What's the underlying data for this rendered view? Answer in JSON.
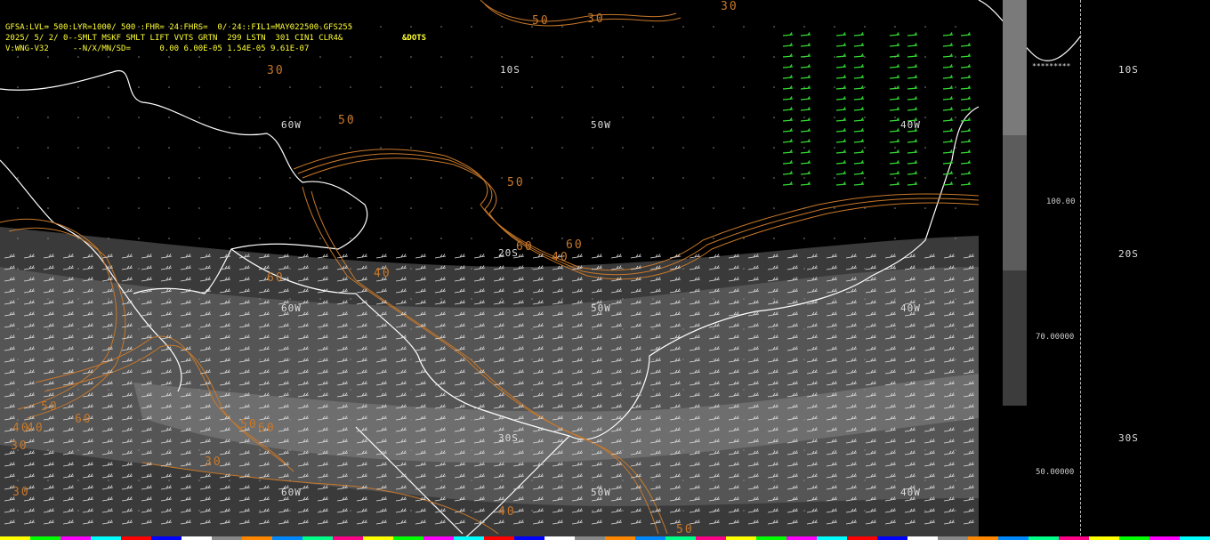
{
  "header": {
    "line1": "GFSA:LVL= 500:LYR=1000/ 500 :FHR= 24:FHRS=  0/ 24::FIL1=MAY022500.GFS255",
    "line2": "2025/ 5/ 2/ 0--SMLT MSKF SMLT LIFT VVTS GRTN  299 LSTN  301 CIN1 CLR4&",
    "line2_tag": "&DOTS",
    "line3": "V:WNG-V32     --N/X/MN/SD=      0.00 6.00E-05 1.54E-05 9.61E-07"
  },
  "map_labels": {
    "lat": [
      "10S",
      "20S",
      "30S"
    ],
    "lon": [
      "60W",
      "50W",
      "40W"
    ]
  },
  "contours": {
    "labels": [
      "30",
      "40",
      "50",
      "60",
      "30",
      "40",
      "50",
      "60",
      "60",
      "50",
      "40",
      "50",
      "30",
      "60",
      "60",
      "50",
      "40",
      "30",
      "30",
      "30",
      "40",
      "50"
    ]
  },
  "colorbar": {
    "values": [
      "100.00",
      "70.00000",
      "50.00000"
    ],
    "stars": "*********",
    "colors": [
      "#7a7a7a",
      "#5c5c5c",
      "#3c3c3c"
    ]
  },
  "sidebar": {
    "lat": [
      "10S",
      "20S",
      "30S"
    ]
  },
  "colors": {
    "contour": "#c8782a",
    "coast": "#ffffff",
    "wind_green": "#33dd33",
    "header": "#ffff33"
  }
}
